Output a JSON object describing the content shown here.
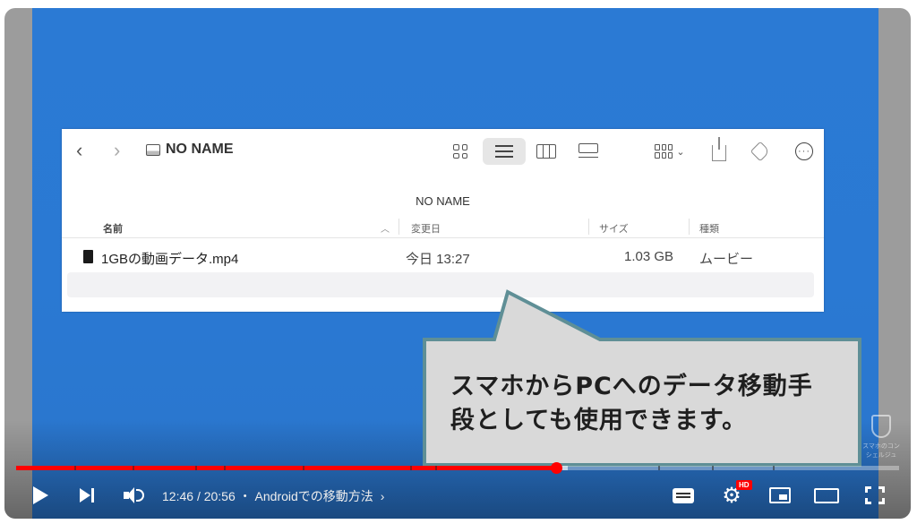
{
  "finder": {
    "title": "NO NAME",
    "path_label": "NO NAME",
    "columns": {
      "name": "名前",
      "date": "変更日",
      "size": "サイズ",
      "kind": "種類"
    },
    "files": [
      {
        "name": "1GBの動画データ.mp4",
        "date": "今日 13:27",
        "size": "1.03 GB",
        "kind": "ムービー"
      }
    ]
  },
  "caption": {
    "line1": "スマホからPCへのデータ移動手",
    "line2": "段としても使用できます。"
  },
  "player": {
    "time_current": "12:46",
    "time_total": "20:56",
    "chapter": "Androidでの移動方法",
    "hd_badge": "HD",
    "progress_played": 0.612,
    "progress_buffered": 0.625,
    "accent_color": "#ff0000"
  },
  "watermark": {
    "text": "スマホのコンシェルジュ"
  }
}
